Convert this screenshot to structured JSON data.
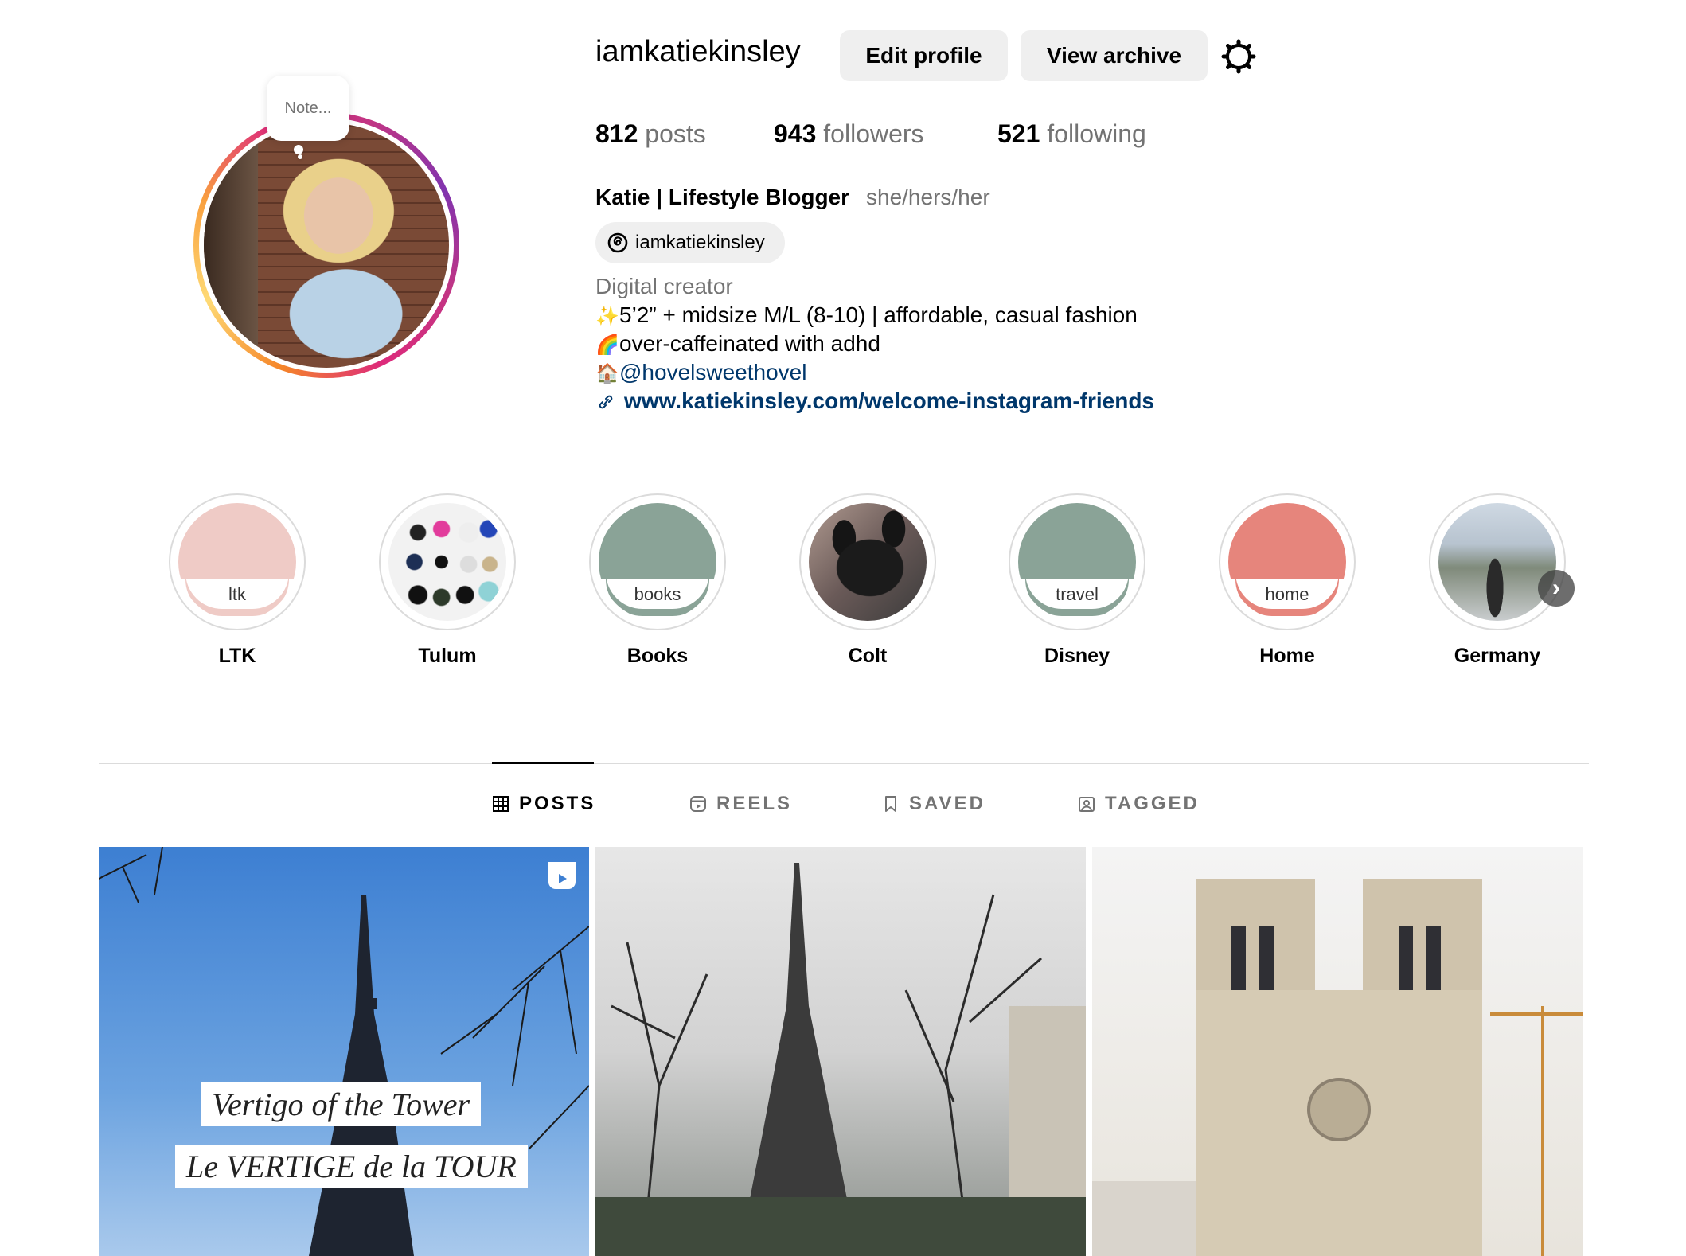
{
  "profile": {
    "note": "Note...",
    "username": "iamkatiekinsley",
    "edit_label": "Edit profile",
    "archive_label": "View archive",
    "posts_count": "812",
    "posts_label": "posts",
    "followers_count": "943",
    "followers_label": "followers",
    "following_count": "521",
    "following_label": "following",
    "full_name": "Katie | Lifestyle Blogger",
    "pronouns": "she/hers/her",
    "threads_handle": "iamkatiekinsley",
    "category": "Digital creator",
    "bio": [
      {
        "emoji": "✨",
        "text": "5’2” + midsize M/L (8-10) | affordable, casual fashion"
      },
      {
        "emoji": "🌈",
        "text": "over-caffeinated with adhd"
      },
      {
        "emoji": "🏠",
        "text": "@hovelsweethovel"
      }
    ],
    "link": "www.katiekinsley.com/welcome-instagram-friends"
  },
  "highlights": [
    {
      "label": "LTK",
      "inner": "ltk",
      "color": "#efcbc6",
      "ring": "#efcbc6"
    },
    {
      "label": "Tulum",
      "inner": "",
      "color": "#ffffff"
    },
    {
      "label": "Books",
      "inner": "books",
      "color": "#8aa397",
      "ring": "#8aa397"
    },
    {
      "label": "Colt",
      "inner": "",
      "color": "#2a2a2a"
    },
    {
      "label": "Disney",
      "inner": "travel",
      "color": "#8aa397",
      "ring": "#8aa397"
    },
    {
      "label": "Home",
      "inner": "home",
      "color": "#e6857c",
      "ring": "#e6857c"
    },
    {
      "label": "Germany",
      "inner": "",
      "color": "#9fb3c9"
    }
  ],
  "tabs": [
    {
      "label": "POSTS",
      "icon": "grid-icon",
      "active": true
    },
    {
      "label": "REELS",
      "icon": "reels-icon",
      "active": false
    },
    {
      "label": "SAVED",
      "icon": "bookmark-icon",
      "active": false
    },
    {
      "label": "TAGGED",
      "icon": "tagged-icon",
      "active": false
    }
  ],
  "posts": [
    {
      "caption_1": "Vertigo of the Tower",
      "caption_2": "Le VERTIGE de la TOUR",
      "is_reel": true
    },
    {
      "is_reel": false
    },
    {
      "is_reel": false
    }
  ],
  "colors": {
    "link": "#00376b",
    "secondary_text": "#737373",
    "button_bg": "#efefef"
  }
}
